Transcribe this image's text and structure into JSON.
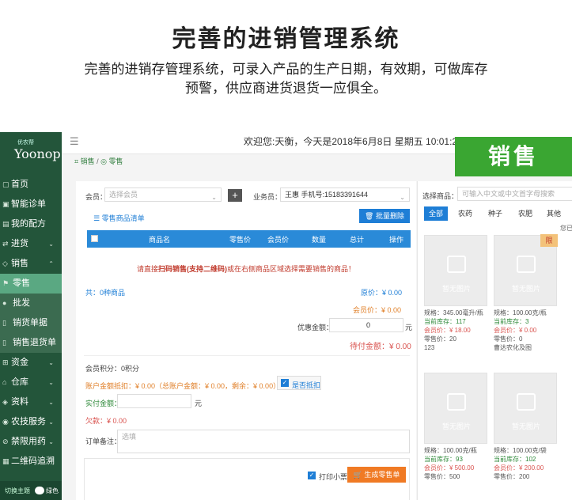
{
  "hero": {
    "title": "完善的进销管理系统",
    "desc_line1": "完善的进销存管理系统，可录入产品的生产日期，有效期，可做库存",
    "desc_line2": "预警，供应商进货退货一应俱全。"
  },
  "sidebar": {
    "logo_small": "优农帮",
    "logo_main": "Yoonop",
    "items": [
      {
        "label": "首页",
        "chev": ""
      },
      {
        "label": "智能诊单",
        "chev": ""
      },
      {
        "label": "我的配方",
        "chev": ""
      },
      {
        "label": "进货",
        "chev": "⌄"
      },
      {
        "label": "销售",
        "chev": "⌃"
      },
      {
        "label": "零售",
        "chev": ""
      },
      {
        "label": "批发",
        "chev": ""
      },
      {
        "label": "销货单据",
        "chev": ""
      },
      {
        "label": "销售退货单",
        "chev": ""
      },
      {
        "label": "资金",
        "chev": "⌄"
      },
      {
        "label": "仓库",
        "chev": "⌄"
      },
      {
        "label": "资料",
        "chev": "⌄"
      },
      {
        "label": "农技服务",
        "chev": "⌄"
      },
      {
        "label": "禁限用药",
        "chev": "⌄"
      },
      {
        "label": "二维码追溯",
        "chev": ""
      }
    ],
    "theme_label": "切换主题",
    "theme_value": "绿色"
  },
  "topbar": {
    "welcome": "欢迎您:天衡，今天是2018年6月8日 星期五 10:01:21",
    "badge": "销售"
  },
  "breadcrumb": {
    "part1": "销售",
    "sep": "/",
    "part2": "零售"
  },
  "form": {
    "member_label": "会员：",
    "member_placeholder": "选择会员",
    "salesperson_label": "业务员：",
    "salesperson_value": "王惠 手机号:15183391644",
    "list_title": "零售商品清单",
    "batch_delete": "批量删除",
    "columns": [
      "商品名",
      "零售价",
      "会员价",
      "数量",
      "总计",
      "操作"
    ],
    "empty_prefix": "请直接",
    "empty_highlight": "扫码销售(支持二维码)",
    "empty_suffix": "或在右侧商品区域选择需要销售的商品！",
    "total_label": "共：",
    "total_count": "0",
    "total_unit": "种商品",
    "orig_price": "原价：¥ 0.00",
    "member_price": "会员价：¥ 0.00",
    "discount_label": "优惠金额：",
    "discount_value": "0",
    "discount_unit": "元",
    "payable": "待付金额：¥ 0.00",
    "points": "会员积分：0积分",
    "deduction": "账户金额抵扣：¥ 0.00（总账户金额：¥ 0.00，剩余：¥ 0.00），",
    "deduction_toggle": "是否抵扣",
    "paid_label": "实付金额：",
    "paid_unit": "元",
    "owed": "欠款：¥ 0.00",
    "remark_label": "订单备注：",
    "remark_placeholder": "选填",
    "print_label": "打印小票",
    "submit": "生成零售单"
  },
  "products": {
    "search_label": "选择商品：",
    "search_placeholder": "可输入中文或中文首字母搜索",
    "tabs": [
      "全部",
      "农药",
      "种子",
      "农肥",
      "其他"
    ],
    "overflow": "您已",
    "placeholder_text": "暂无图片",
    "ribbon": "限",
    "cards": [
      {
        "spec": "规格：345.00毫升/瓶",
        "stock": "当前库存：117",
        "member": "会员价：¥ 18.00",
        "retail": "零售价：20",
        "extra": "123"
      },
      {
        "spec": "规格：100.00克/瓶",
        "stock": "当前库存：3",
        "member": "会员价：¥ 0.00",
        "retail": "零售价：0",
        "extra": "曹达农化及图"
      },
      {
        "spec": "规格：100.00克/瓶",
        "stock": "当前库存：93",
        "member": "会员价：¥ 500.00",
        "retail": "零售价：500",
        "extra": ""
      },
      {
        "spec": "规格：100.00克/袋",
        "stock": "当前库存：102",
        "member": "会员价：¥ 200.00",
        "retail": "零售价：200",
        "extra": ""
      }
    ]
  }
}
